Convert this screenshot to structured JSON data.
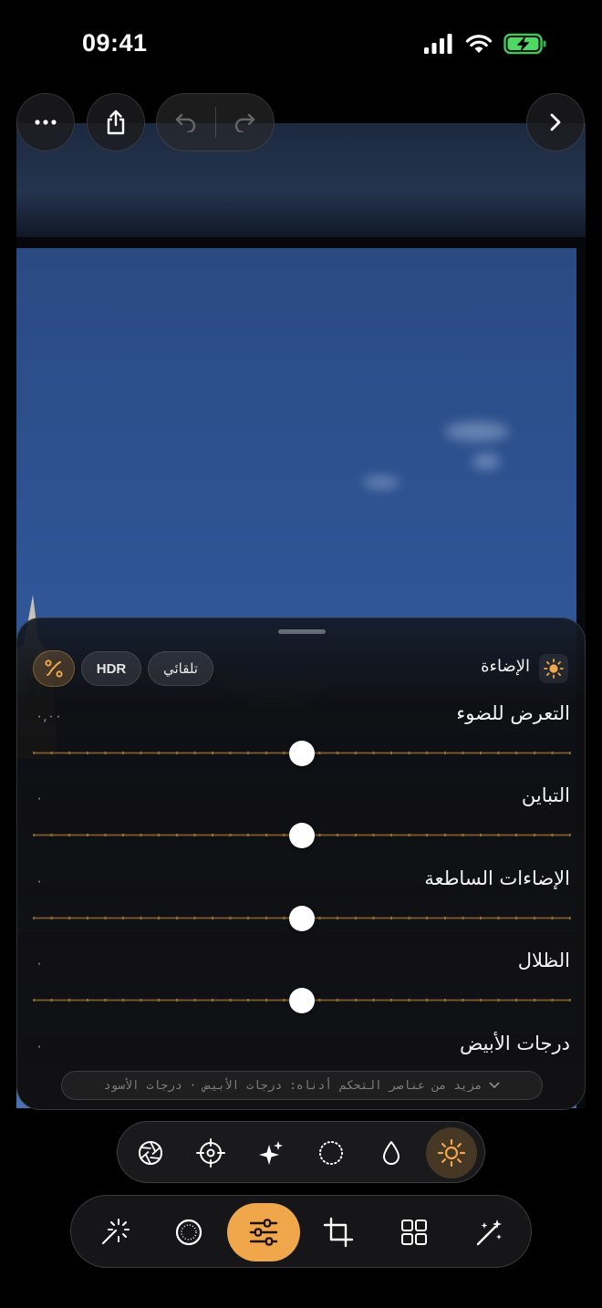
{
  "status_bar": {
    "time": "09:41"
  },
  "top_bar": {
    "more_icon": "ellipsis-icon",
    "share_icon": "share-icon",
    "undo_icon": "undo-icon",
    "redo_icon": "redo-icon",
    "next_icon": "chevron-right-icon"
  },
  "panel": {
    "title": "الإضاءة",
    "title_icon": "sun-icon",
    "auto_label": "تلقائي",
    "hdr_label": "HDR",
    "curve_icon": "curve-icon",
    "sliders": [
      {
        "label": "التعرض للضوء",
        "value": "٠,٠٠",
        "level": 0
      },
      {
        "label": "التباين",
        "value": "٠",
        "level": 0
      },
      {
        "label": "الإضاءات الساطعة",
        "value": "٠",
        "level": 0
      },
      {
        "label": "الظلال",
        "value": "٠",
        "level": 0
      },
      {
        "label": "درجات الأبيض",
        "value": "٠",
        "level": 0
      }
    ],
    "more_text": "مزيد من عناصر التحكم أدناه: درجات الأبيض · درجات الأسود"
  },
  "tool_switcher": {
    "tools": [
      "aperture-icon",
      "target-icon",
      "sparkle-icon",
      "dotted-circle-icon",
      "drop-icon",
      "sun-icon"
    ],
    "active": "sun-icon"
  },
  "tab_bar": {
    "tabs": [
      "magic-wand-icon",
      "filter-circle-icon",
      "sliders-icon",
      "crop-icon",
      "grid-icon",
      "wand-sparkle-icon"
    ],
    "active": "sliders-icon"
  },
  "colors": {
    "accent": "#f0a64a",
    "background": "#000000"
  }
}
